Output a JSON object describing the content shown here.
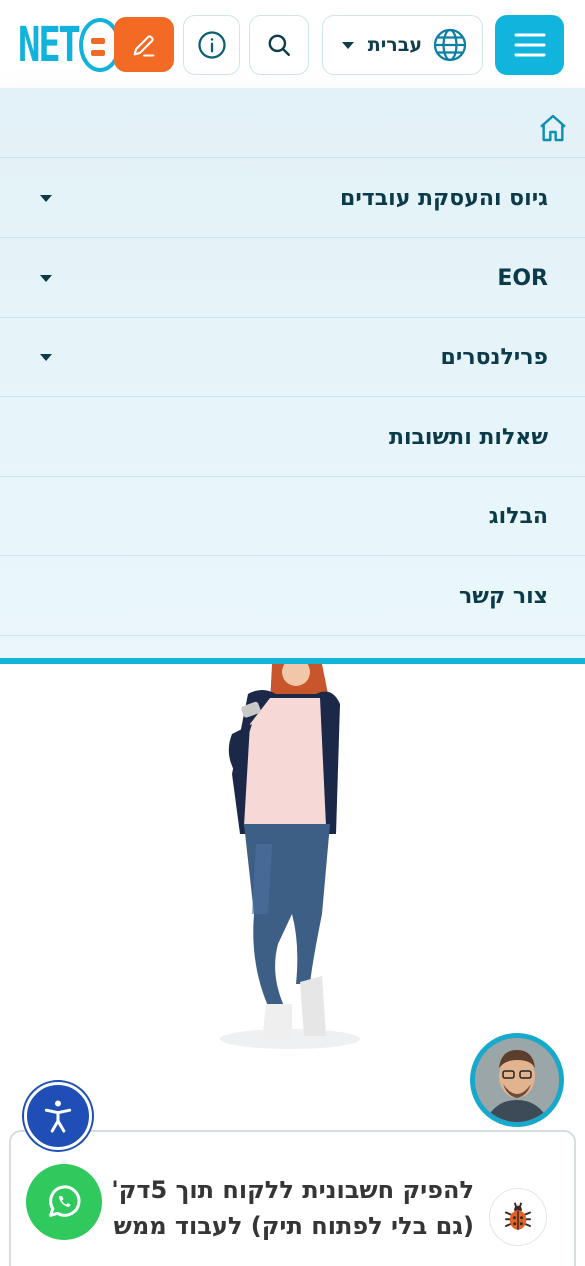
{
  "header": {
    "logo_text": "NET",
    "language": {
      "label": "עברית",
      "icon": "globe-icon"
    },
    "buttons": {
      "menu_icon": "hamburger-icon",
      "search_icon": "search-icon",
      "info_icon": "info-icon",
      "edit_icon": "pencil-icon"
    }
  },
  "menu": {
    "home_icon": "home-icon",
    "items": [
      {
        "label": "גיוס והעסקת עובדים",
        "has_dropdown": true
      },
      {
        "label": "EOR",
        "has_dropdown": true
      },
      {
        "label": "פרילנסרים",
        "has_dropdown": true
      },
      {
        "label": "שאלות ותשובות",
        "has_dropdown": false
      },
      {
        "label": "הבלוג",
        "has_dropdown": false
      },
      {
        "label": "צור קשר",
        "has_dropdown": false
      }
    ]
  },
  "card": {
    "line1": "להפיק חשבונית ללקוח תוך 5דק'",
    "line2": "(גם בלי לפתוח תיק) לעבוד ממש"
  },
  "floating": {
    "chat_avatar": "support-agent-avatar",
    "accessibility_icon": "accessibility-icon",
    "whatsapp_icon": "whatsapp-icon",
    "bug_icon": "ladybug-icon"
  },
  "colors": {
    "brand_cyan": "#10b4dc",
    "brand_orange": "#f26a23",
    "menu_bg": "#e3f2f8",
    "text_dark": "#0b3a4a",
    "whatsapp_green": "#2fc95e",
    "accessibility_blue": "#1f4fb6"
  }
}
